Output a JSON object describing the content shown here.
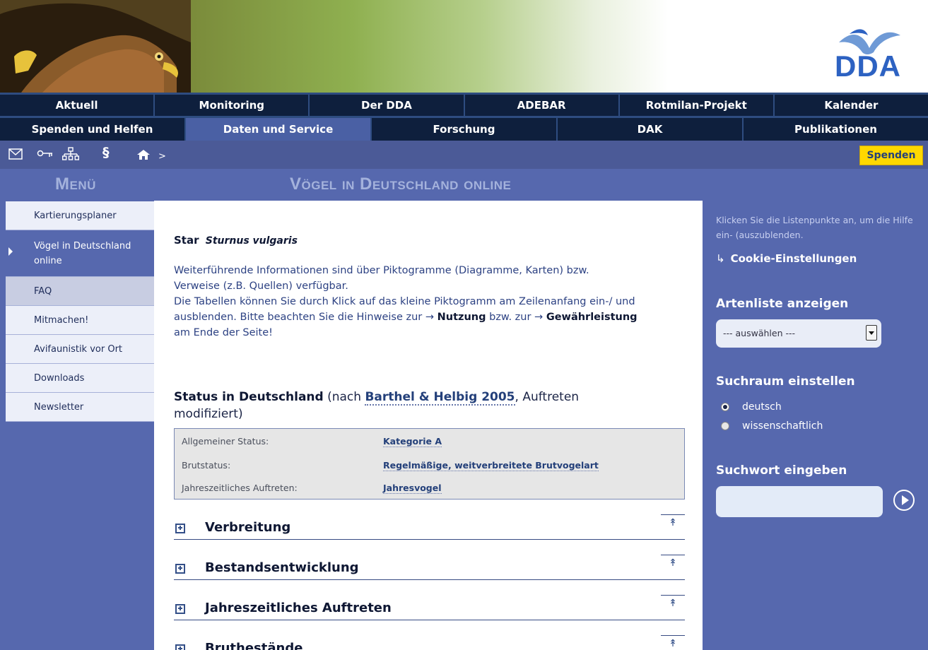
{
  "banner": {
    "logo_text": "DDA"
  },
  "nav": {
    "row1": [
      "Aktuell",
      "Monitoring",
      "Der DDA",
      "ADEBAR",
      "Rotmilan-Projekt",
      "Kalender"
    ],
    "row2": [
      "Spenden und Helfen",
      "Daten und Service",
      "Forschung",
      "DAK",
      "Publikationen"
    ],
    "row2_active": "Daten und Service"
  },
  "toolbar": {
    "icons": [
      "mail-icon",
      "key-icon",
      "sitemap-icon",
      "paragraph-icon",
      "home-icon"
    ],
    "paragraph_glyph": "§",
    "breadcrumb_sep": ">",
    "donate_label": "Spenden"
  },
  "headings": {
    "menu": "Menü",
    "page": "Vögel in Deutschland online"
  },
  "sidebar": {
    "items": [
      {
        "label": "Kartierungsplaner"
      },
      {
        "label": "Vögel in Deutschland online",
        "current": true
      },
      {
        "label": "FAQ"
      },
      {
        "label": "Mitmachen!"
      },
      {
        "label": "Avifaunistik vor Ort"
      },
      {
        "label": "Downloads"
      },
      {
        "label": "Newsletter"
      }
    ]
  },
  "main": {
    "species_name": "Star",
    "species_latin": "Sturnus vulgaris",
    "intro_line1": "Weiterführende Informationen sind über Piktogramme (Diagramme, Karten) bzw.",
    "intro_line2": "Verweise (z.B. Quellen) verfügbar.",
    "intro_line3": "Die Tabellen können Sie durch Klick auf das kleine Piktogramm am Zeilenanfang ein-/ und",
    "intro_line4_pre": "ausblenden. Bitte beachten Sie die Hinweise zur",
    "intro_link1": "Nutzung",
    "intro_mid": "bzw. zur",
    "intro_link2": "Gewährleistung",
    "intro_line5": "am Ende der Seite!",
    "arrow": "→",
    "status_title": "Status in Deutschland",
    "status_pre": "(nach",
    "status_link": "Barthel & Helbig 2005",
    "status_post": ", Auftreten modifiziert)",
    "status_rows": [
      {
        "label": "Allgemeiner Status:",
        "value": "Kategorie A"
      },
      {
        "label": "Brutstatus:",
        "value": "Regelmäßige, weitverbreitete Brutvogelart"
      },
      {
        "label": "Jahreszeitliches Auftreten:",
        "value": "Jahresvogel"
      }
    ],
    "sections": [
      "Verbreitung",
      "Bestandsentwicklung",
      "Jahreszeitliches Auftreten",
      "Bruthestände"
    ],
    "to_top_glyph": "↟"
  },
  "rightbar": {
    "help_text": "Klicken Sie die Listenpunkte an, um die Hilfe ein- (auszublenden.",
    "cookie_arrow": "↳",
    "cookie_label": "Cookie-Einstellungen",
    "species_list_heading": "Artenliste anzeigen",
    "select_value": "--- auswählen ---",
    "search_scope_heading": "Suchraum einstellen",
    "radio_options": [
      {
        "label": "deutsch",
        "checked": true
      },
      {
        "label": "wissenschaftlich",
        "checked": false
      }
    ],
    "search_word_heading": "Suchwort eingeben",
    "search_value": ""
  },
  "colors": {
    "nav_bg": "#0e1f3d",
    "nav_active": "#4a60a4",
    "panel": "#5668ae",
    "donate": "#ffd800",
    "logo_blue": "#2d62c2"
  }
}
